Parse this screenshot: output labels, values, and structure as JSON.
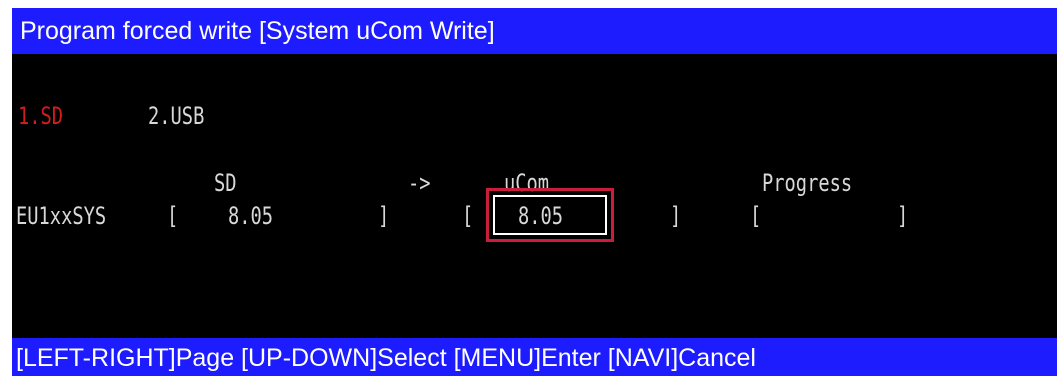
{
  "header": {
    "title": "Program forced write [System uCom Write]"
  },
  "tabs": [
    {
      "label": "1.SD",
      "selected": true
    },
    {
      "label": "2.USB",
      "selected": false
    }
  ],
  "columns": {
    "source": "SD",
    "arrow": "->",
    "target": "uCom",
    "progress": "Progress"
  },
  "row": {
    "name": "EU1xxSYS",
    "open_bracket": "[",
    "close_bracket": "]",
    "sd_version": "8.05",
    "ucom_version": "8.05",
    "progress_value": ""
  },
  "footer": {
    "hint": "[LEFT-RIGHT]Page  [UP-DOWN]Select  [MENU]Enter  [NAVI]Cancel"
  },
  "colors": {
    "bar_blue": "#1c1cff",
    "selected_tab": "#d21c1c",
    "highlight_box": "#c81e3c",
    "text": "#d8d8d8",
    "background": "#000000"
  }
}
